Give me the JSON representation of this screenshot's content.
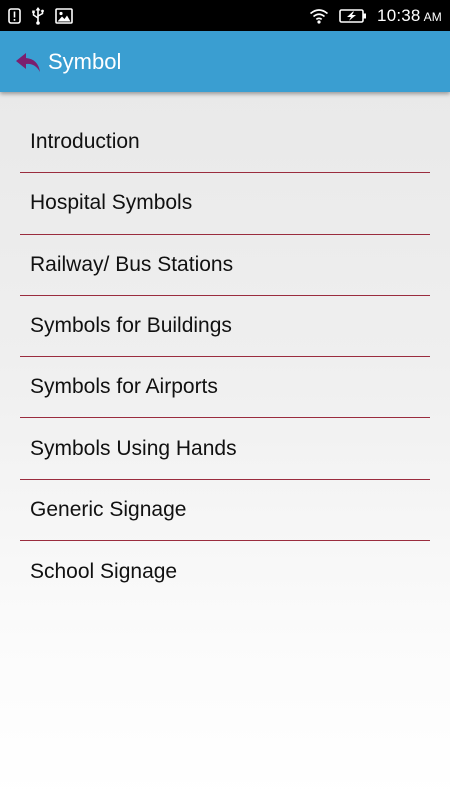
{
  "status_bar": {
    "time": "10:38",
    "ampm": "AM",
    "icons": [
      "alert-icon",
      "usb-icon",
      "image-icon",
      "wifi-icon",
      "battery-charging-icon"
    ]
  },
  "app_bar": {
    "title": "Symbol",
    "back_icon": "back-arrow-icon",
    "background": "#3a9ed1",
    "back_icon_color": "#7b1f6f"
  },
  "menu": {
    "divider_color": "#9a2c3e",
    "items": [
      {
        "label": "Introduction"
      },
      {
        "label": "Hospital Symbols"
      },
      {
        "label": "Railway/ Bus Stations"
      },
      {
        "label": "Symbols for Buildings"
      },
      {
        "label": "Symbols for Airports"
      },
      {
        "label": "Symbols Using Hands"
      },
      {
        "label": "Generic Signage"
      },
      {
        "label": "School Signage"
      }
    ]
  }
}
